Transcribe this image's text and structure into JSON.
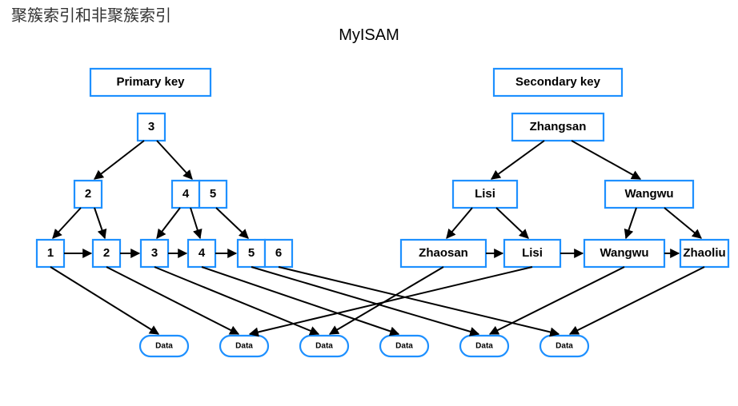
{
  "cornerTitle": "聚簇索引和非聚簇索引",
  "diagramTitle": "MyISAM",
  "primary": {
    "header": "Primary key",
    "root": "3",
    "level2": [
      "2",
      "4",
      "5"
    ],
    "leaf": [
      "1",
      "2",
      "3",
      "4",
      "5",
      "6"
    ]
  },
  "secondary": {
    "header": "Secondary key",
    "root": "Zhangsan",
    "level2": [
      "Lisi",
      "Wangwu"
    ],
    "leaf": [
      "Zhaosan",
      "Lisi",
      "Wangwu",
      "Zhaoliu"
    ]
  },
  "dataLabel": "Data"
}
